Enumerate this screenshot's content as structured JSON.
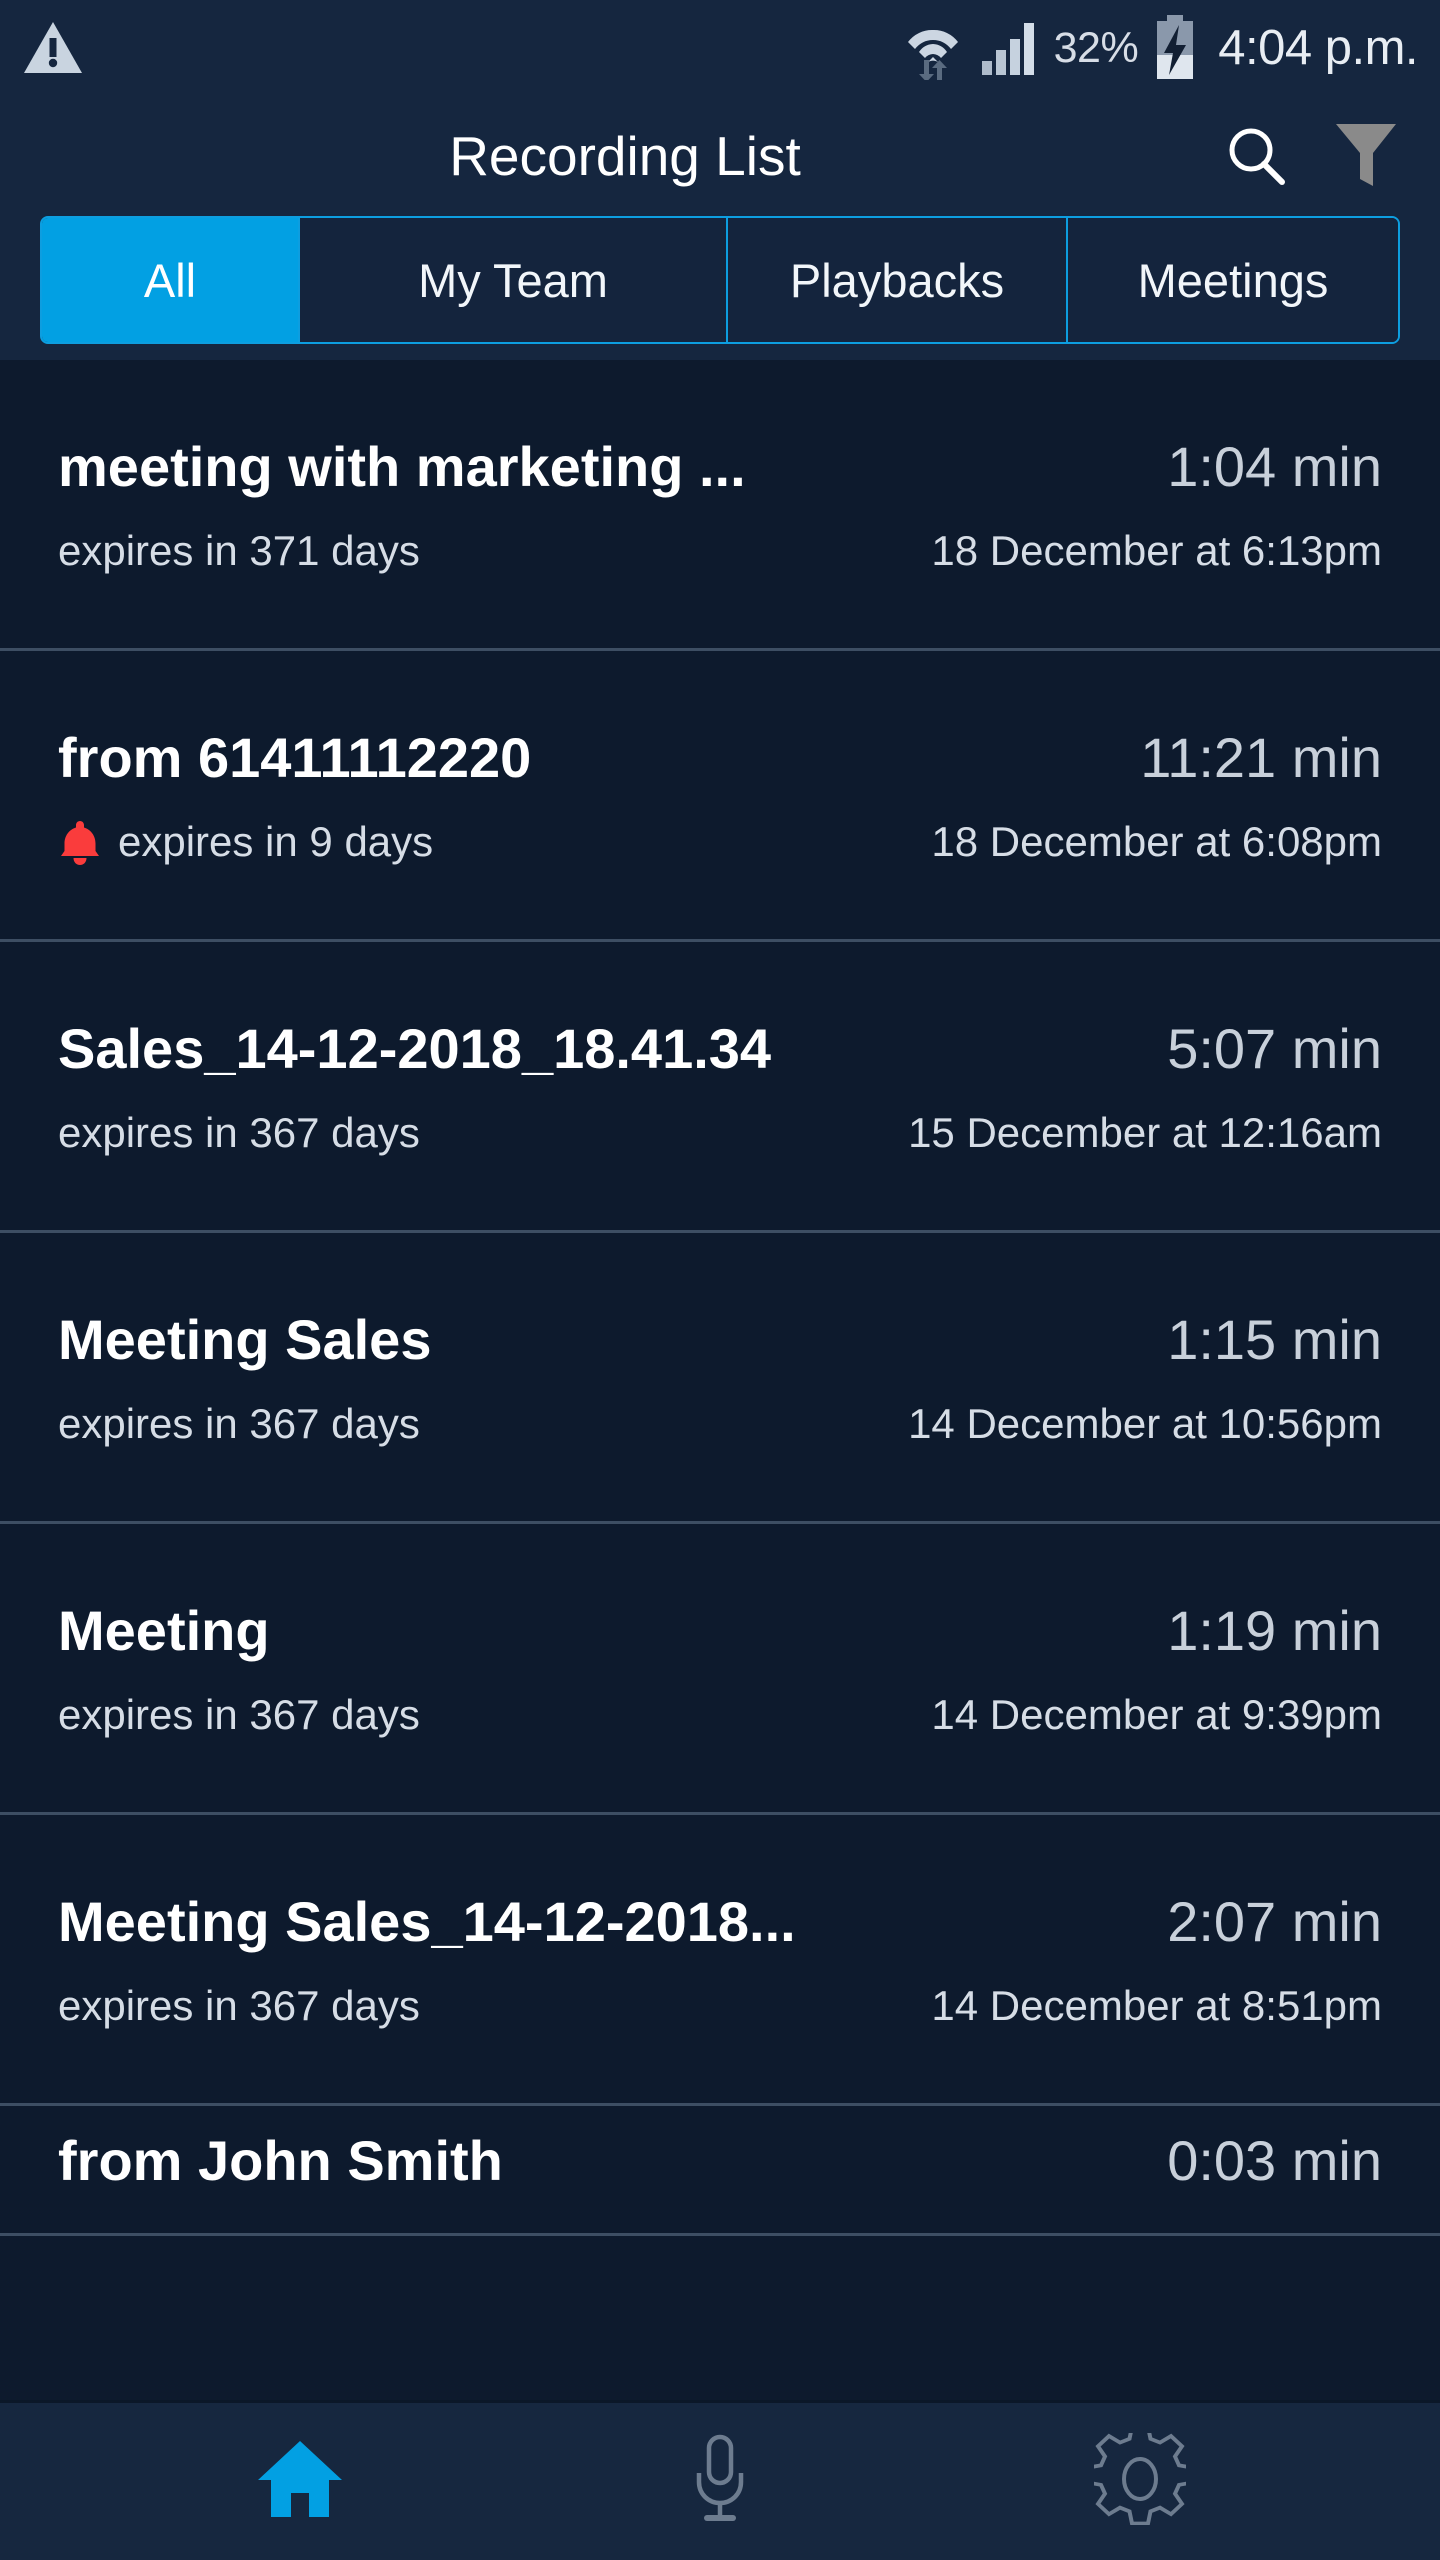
{
  "colors": {
    "background": "#0d1a2d",
    "chrome": "#15263f",
    "accent": "#02a0e3",
    "accent_border": "#0d9ee0",
    "divider": "#3d4e63",
    "alert_red": "#fa3c3c",
    "icon_gray": "#8a8a8a"
  },
  "status_bar": {
    "warning_icon": "warning-triangle-icon",
    "wifi_icon": "wifi-icon",
    "signal_icon": "cellular-signal-icon",
    "battery_percent": "32%",
    "battery_icon": "battery-charging-icon",
    "time": "4:04 p.m."
  },
  "header": {
    "title": "Recording List",
    "search_icon": "search-icon",
    "filter_icon": "filter-funnel-icon"
  },
  "tabs": [
    {
      "label": "All",
      "active": true
    },
    {
      "label": "My Team",
      "active": false
    },
    {
      "label": "Playbacks",
      "active": false
    },
    {
      "label": "Meetings",
      "active": false
    }
  ],
  "recordings": [
    {
      "title": "meeting with marketing ...",
      "expiry": "expires in 371 days",
      "duration": "1:04 min",
      "date": "18 December at 6:13pm",
      "alert": false
    },
    {
      "title": "from 61411112220",
      "expiry": "expires in 9 days",
      "duration": "11:21 min",
      "date": "18 December at 6:08pm",
      "alert": true
    },
    {
      "title": "Sales_14-12-2018_18.41.34",
      "expiry": "expires in 367 days",
      "duration": "5:07 min",
      "date": "15 December at 12:16am",
      "alert": false
    },
    {
      "title": "Meeting Sales",
      "expiry": "expires in 367 days",
      "duration": "1:15 min",
      "date": "14 December at 10:56pm",
      "alert": false
    },
    {
      "title": "Meeting",
      "expiry": "expires in 367 days",
      "duration": "1:19 min",
      "date": "14 December at 9:39pm",
      "alert": false
    },
    {
      "title": "Meeting Sales_14-12-2018...",
      "expiry": "expires in 367 days",
      "duration": "2:07 min",
      "date": "14 December at 8:51pm",
      "alert": false
    },
    {
      "title": "from John Smith",
      "expiry": "",
      "duration": "0:03 min",
      "date": "",
      "alert": false,
      "partial": true
    }
  ],
  "bottom_nav": [
    {
      "name": "home",
      "icon": "home-icon",
      "active": true
    },
    {
      "name": "record",
      "icon": "microphone-icon",
      "active": false
    },
    {
      "name": "settings",
      "icon": "gear-icon",
      "active": false
    }
  ]
}
